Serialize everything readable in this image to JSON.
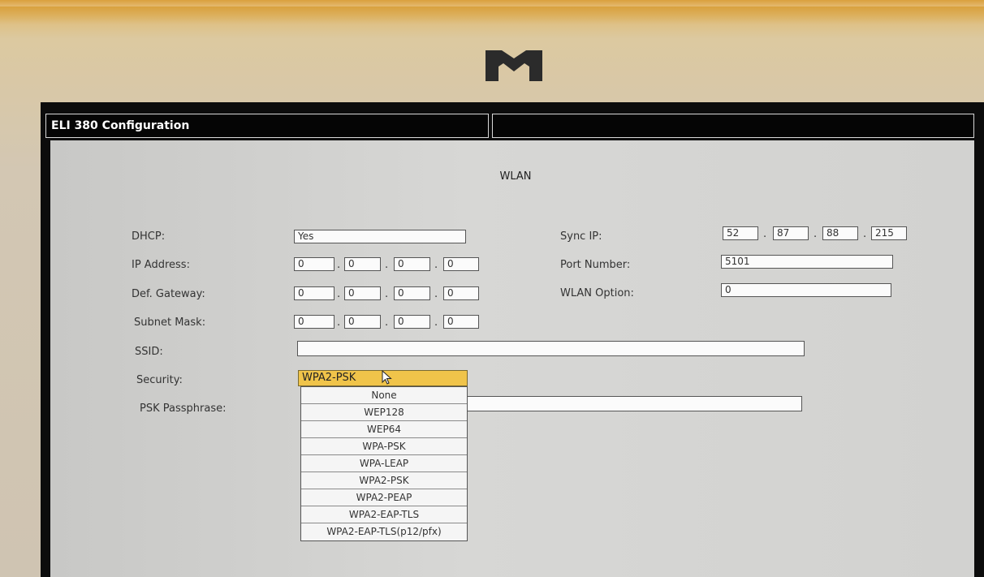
{
  "window": {
    "title": "ELI 380 Configuration"
  },
  "section": {
    "title": "WLAN"
  },
  "labels": {
    "dhcp": "DHCP:",
    "ip_address": "IP Address:",
    "def_gateway": "Def. Gateway:",
    "subnet_mask": "Subnet Mask:",
    "ssid": "SSID:",
    "security": "Security:",
    "psk_passphrase": "PSK Passphrase:",
    "sync_ip": "Sync IP:",
    "port_number": "Port Number:",
    "wlan_option": "WLAN Option:"
  },
  "fields": {
    "dhcp": "Yes",
    "ip_address": [
      "0",
      "0",
      "0",
      "0"
    ],
    "def_gateway": [
      "0",
      "0",
      "0",
      "0"
    ],
    "subnet_mask": [
      "0",
      "0",
      "0",
      "0"
    ],
    "ssid": "",
    "psk_passphrase": "",
    "sync_ip": [
      "52",
      "87",
      "88",
      "215"
    ],
    "port_number": "5101",
    "wlan_option": "0"
  },
  "ip_separator": ".",
  "security": {
    "selected": "WPA2-PSK",
    "options": [
      "None",
      "WEP128",
      "WEP64",
      "WPA-PSK",
      "WPA-LEAP",
      "WPA2-PSK",
      "WPA2-PEAP",
      "WPA2-EAP-TLS",
      "WPA2-EAP-TLS(p12/pfx)"
    ]
  },
  "icons": {
    "logo": "heart-logo-icon",
    "cursor": "mouse-pointer-icon"
  },
  "colors": {
    "bezel": "#d3c7b3",
    "screen_bg": "#d2d2d0",
    "selection": "#f0c44a",
    "titlebar": "#050505"
  }
}
